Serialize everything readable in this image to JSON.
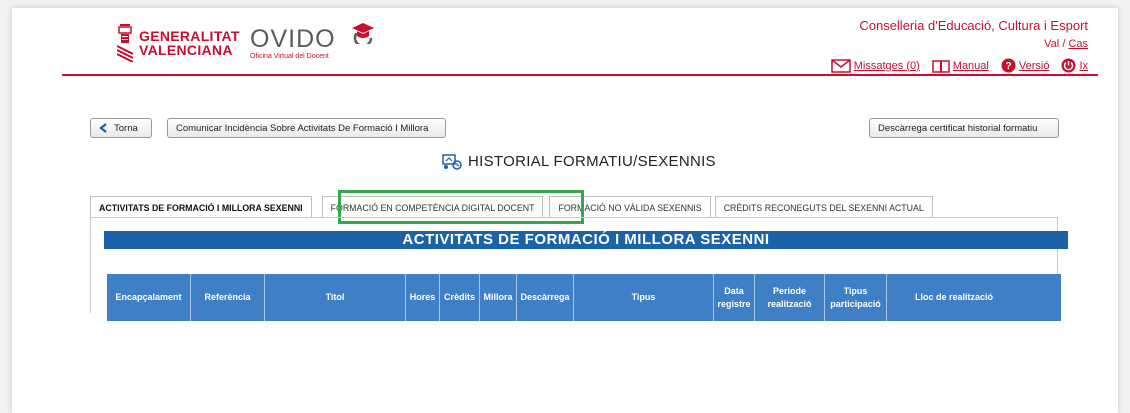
{
  "header": {
    "gv_line1": "GENERALITAT",
    "gv_line2": "VALENCIANA",
    "app_name": "OVIDO",
    "app_subtitle": "Oficina Virtual del Docent",
    "conselleria": "Conselleria d'Educació, Cultura i Esport",
    "lang_val": "Val",
    "lang_sep": "/",
    "lang_cas": "Cas",
    "links": {
      "missatges": "Missatges (0)",
      "manual": "Manual",
      "versio": "Versió",
      "exit": "Ix"
    }
  },
  "toolbar": {
    "back": "Torna",
    "incidencia": "Comunicar Incidència Sobre Activitats De Formació I Millora",
    "certificat": "Descàrrega certificat historial formatiu"
  },
  "page_title": "HISTORIAL FORMATIU/SEXENNIS",
  "tabs": [
    {
      "label": "ACTIVITATS DE FORMACIÓ I MILLORA SEXENNI"
    },
    {
      "label": "FORMACIÓ EN COMPETÈNCIA DIGITAL DOCENT"
    },
    {
      "label": "FORMACIÓ NO VÀLIDA SEXENNIS"
    },
    {
      "label": "CRÈDITS RECONEGUTS DEL SEXENNI ACTUAL"
    }
  ],
  "section_title": "ACTIVITATS DE FORMACIÓ I MILLORA SEXENNI",
  "table": {
    "columns": [
      {
        "l1": "Encapçalament",
        "l2": ""
      },
      {
        "l1": "Referència",
        "l2": ""
      },
      {
        "l1": "Titol",
        "l2": ""
      },
      {
        "l1": "Hores",
        "l2": ""
      },
      {
        "l1": "Crèdits",
        "l2": ""
      },
      {
        "l1": "Millora",
        "l2": ""
      },
      {
        "l1": "Descàrrega",
        "l2": ""
      },
      {
        "l1": "Tipus",
        "l2": ""
      },
      {
        "l1": "Data",
        "l2": "registre"
      },
      {
        "l1": "Periode",
        "l2": "realització"
      },
      {
        "l1": "Tipus",
        "l2": "participació"
      },
      {
        "l1": "Lloc de realització",
        "l2": ""
      }
    ]
  },
  "colors": {
    "brand_red": "#c8102e",
    "header_blue": "#1a63a8",
    "table_blue": "#3e7fc6",
    "highlight_green": "#34a84a"
  }
}
